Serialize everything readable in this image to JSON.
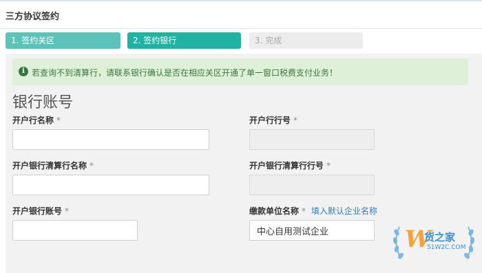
{
  "page": {
    "title": "三方协议签约"
  },
  "steps": [
    {
      "label": "1. 签约关区",
      "state": "done"
    },
    {
      "label": "2. 签约银行",
      "state": "active"
    },
    {
      "label": "3. 完成",
      "state": "pending"
    }
  ],
  "alert": {
    "icon": "info-icon",
    "message": "若查询不到清算行，请联系银行确认是否在相应关区开通了单一窗口税费支付业务！"
  },
  "section": {
    "title": "银行账号"
  },
  "form": {
    "bank_name": {
      "label": "开户行名称",
      "required": "*",
      "value": ""
    },
    "bank_code": {
      "label": "开户行行号",
      "required": "*",
      "value": ""
    },
    "clearing_bank_name": {
      "label": "开户银行清算行名称",
      "required": "*",
      "value": ""
    },
    "clearing_bank_code": {
      "label": "开户银行清算行行号",
      "required": "*",
      "value": ""
    },
    "account_no": {
      "label": "开户银行账号",
      "required": "*",
      "value": ""
    },
    "payer_name": {
      "label": "缴款单位名称",
      "required": "*",
      "value": "中心自用测试企业",
      "fill_default_link": "填入默认企业名称"
    }
  },
  "colors": {
    "step_done": "#5cc2ba",
    "step_active": "#20b2a2",
    "step_pending": "#ececec",
    "alert_bg": "#dff0d8",
    "alert_text": "#3c763d",
    "link": "#2f7db8"
  },
  "watermark": {
    "logo": "W",
    "name": "货之家",
    "url": "51W2C.COM"
  }
}
